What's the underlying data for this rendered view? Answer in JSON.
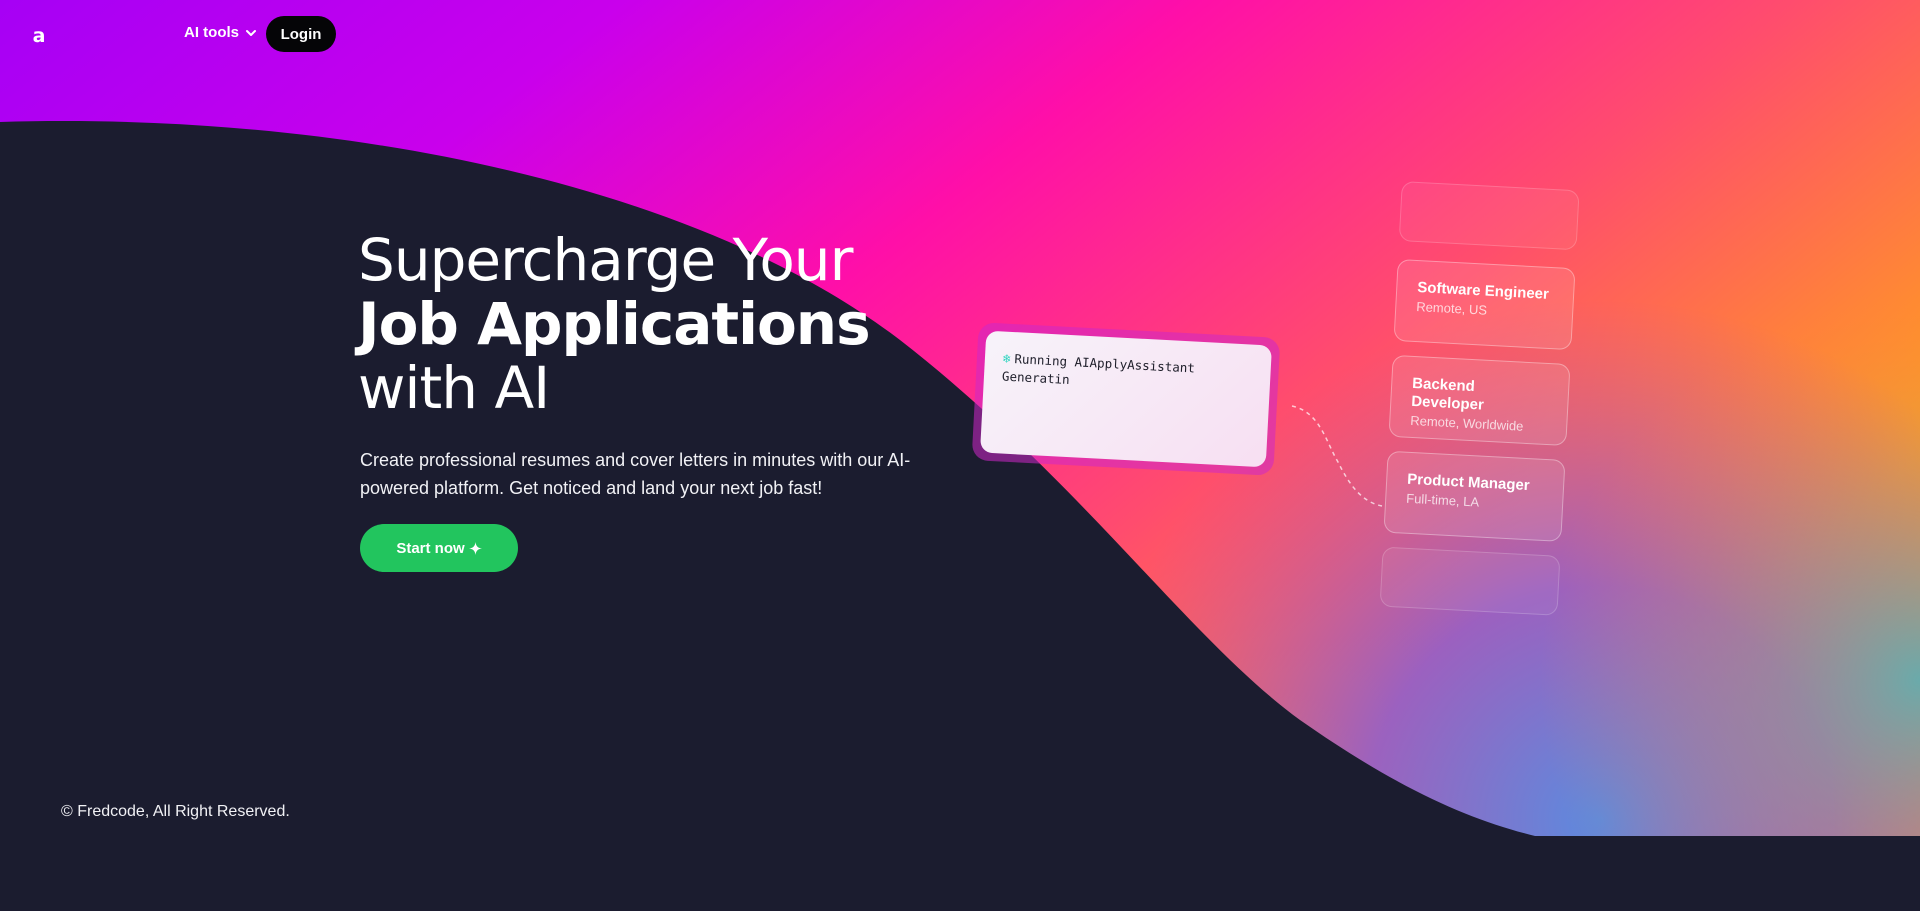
{
  "nav": {
    "logo": "a",
    "tools_label": "AI tools",
    "login_label": "Login"
  },
  "hero": {
    "title_line1": "Supercharge Your",
    "title_line2": "Job Applications",
    "title_line3": "with AI",
    "subtitle": "Create professional resumes and cover letters in minutes with our AI-powered platform. Get noticed and land your next job fast!",
    "cta_label": "Start now"
  },
  "terminal": {
    "line1": "Running AIApplyAssistant",
    "line2": "Generatin"
  },
  "jobs": [
    {
      "title": "Software Engineer",
      "meta": "Remote, US"
    },
    {
      "title": "Backend Developer",
      "meta": "Remote, Worldwide"
    },
    {
      "title": "Product Manager",
      "meta": "Full-time, LA"
    }
  ],
  "footer": {
    "copyright": "© Fredcode, All Right Reserved."
  },
  "colors": {
    "background": "#1b1c2f",
    "cta": "#22c55e",
    "gradient_purple": "#a800f5",
    "gradient_pink": "#ff0fa7",
    "gradient_orange": "#ffa31a",
    "gradient_teal": "#58a5c4"
  },
  "icons": {
    "tools_chevron": "chevron-down-icon",
    "cta_icon": "sparkle-icon",
    "terminal_icon": "snowflake-icon"
  }
}
